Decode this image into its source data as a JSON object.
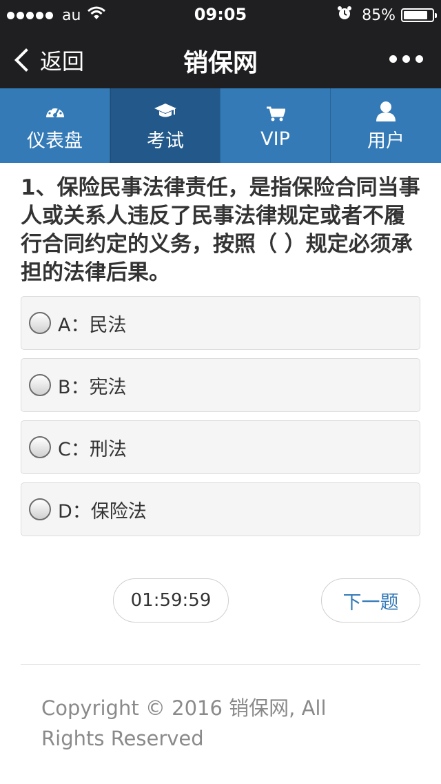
{
  "status_bar": {
    "carrier": "au",
    "time": "09:05",
    "battery_percent": "85%",
    "battery_level": 0.85,
    "icons": [
      "signal-dots",
      "wifi-icon",
      "alarm-icon",
      "battery-icon"
    ]
  },
  "nav": {
    "back_label": "返回",
    "title": "销保网",
    "more_icon": "more-icon"
  },
  "tabs": [
    {
      "label": "仪表盘",
      "icon": "dashboard-icon",
      "active": false
    },
    {
      "label": "考试",
      "icon": "graduation-cap-icon",
      "active": true
    },
    {
      "label": "VIP",
      "icon": "cart-icon",
      "active": false
    },
    {
      "label": "用户",
      "icon": "user-icon",
      "active": false
    }
  ],
  "question": {
    "text": "1、保险民事法律责任，是指保险合同当事人或关系人违反了民事法律规定或者不履行合同约定的义务，按照（ ）规定必须承担的法律后果。"
  },
  "options": [
    {
      "label": "A：民法",
      "selected": false
    },
    {
      "label": "B：宪法",
      "selected": false
    },
    {
      "label": "C：刑法",
      "selected": false
    },
    {
      "label": "D：保险法",
      "selected": false
    }
  ],
  "controls": {
    "timer": "01:59:59",
    "next_label": "下一题"
  },
  "footer": {
    "copyright": "Copyright © 2016 销保网, All Rights Reserved"
  },
  "colors": {
    "bar_bg": "#1f1f21",
    "tab_bg": "#337ab7",
    "tab_active_bg": "#22598a",
    "link": "#337ab7"
  }
}
